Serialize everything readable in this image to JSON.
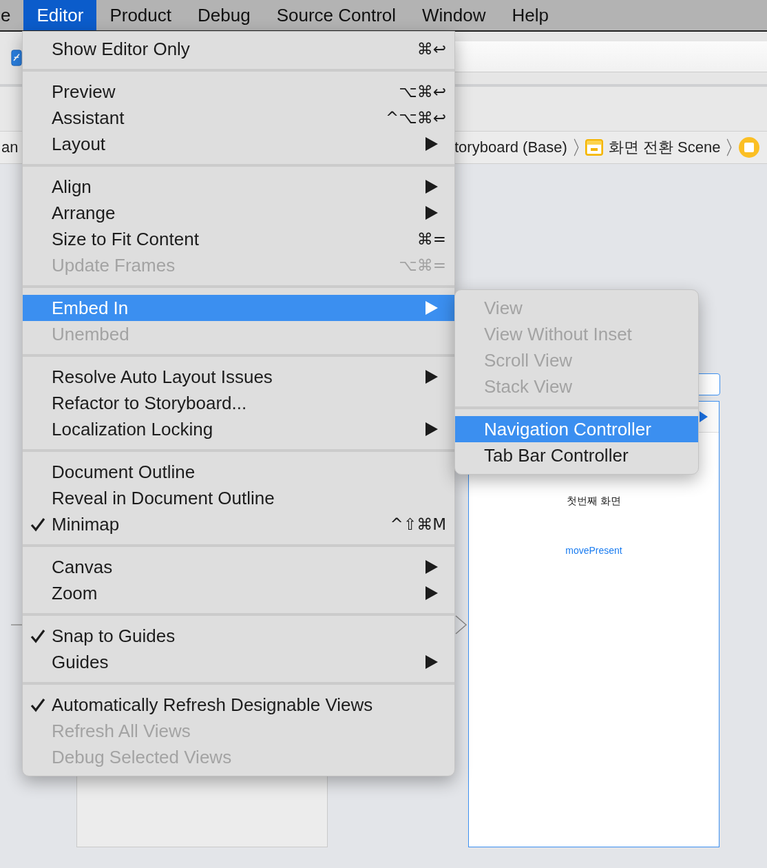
{
  "menubar": [
    {
      "label": "e",
      "selected": false
    },
    {
      "label": "Editor",
      "selected": true
    },
    {
      "label": "Product",
      "selected": false
    },
    {
      "label": "Debug",
      "selected": false
    },
    {
      "label": "Source Control",
      "selected": false
    },
    {
      "label": "Window",
      "selected": false
    },
    {
      "label": "Help",
      "selected": false
    }
  ],
  "breadcrumb": {
    "fragment": "an",
    "items": [
      {
        "label": "toryboard (Base)"
      },
      {
        "label": "화면 전환 Scene"
      }
    ]
  },
  "menu": {
    "groups": [
      [
        {
          "label": "Show Editor Only",
          "shortcut": "⌘↩",
          "kind": "command",
          "checked": false,
          "disabled": false,
          "selected": false
        }
      ],
      [
        {
          "label": "Preview",
          "shortcut": "⌥⌘↩",
          "kind": "command",
          "checked": false,
          "disabled": false,
          "selected": false
        },
        {
          "label": "Assistant",
          "shortcut": "^⌥⌘↩",
          "kind": "command",
          "checked": false,
          "disabled": false,
          "selected": false
        },
        {
          "label": "Layout",
          "kind": "submenu",
          "checked": false,
          "disabled": false,
          "selected": false
        }
      ],
      [
        {
          "label": "Align",
          "kind": "submenu",
          "checked": false,
          "disabled": false,
          "selected": false
        },
        {
          "label": "Arrange",
          "kind": "submenu",
          "checked": false,
          "disabled": false,
          "selected": false
        },
        {
          "label": "Size to Fit Content",
          "shortcut": "⌘=",
          "kind": "command",
          "checked": false,
          "disabled": false,
          "selected": false
        },
        {
          "label": "Update Frames",
          "shortcut": "⌥⌘=",
          "kind": "command",
          "checked": false,
          "disabled": true,
          "selected": false
        }
      ],
      [
        {
          "label": "Embed In",
          "kind": "submenu",
          "checked": false,
          "disabled": false,
          "selected": true
        },
        {
          "label": "Unembed",
          "kind": "command",
          "checked": false,
          "disabled": true,
          "selected": false
        }
      ],
      [
        {
          "label": "Resolve Auto Layout Issues",
          "kind": "submenu",
          "checked": false,
          "disabled": false,
          "selected": false
        },
        {
          "label": "Refactor to Storyboard...",
          "kind": "command",
          "checked": false,
          "disabled": false,
          "selected": false
        },
        {
          "label": "Localization Locking",
          "kind": "submenu",
          "checked": false,
          "disabled": false,
          "selected": false
        }
      ],
      [
        {
          "label": "Document Outline",
          "kind": "command",
          "checked": false,
          "disabled": false,
          "selected": false
        },
        {
          "label": "Reveal in Document Outline",
          "kind": "command",
          "checked": false,
          "disabled": false,
          "selected": false
        },
        {
          "label": "Minimap",
          "shortcut": "^⇧⌘M",
          "kind": "command",
          "checked": true,
          "disabled": false,
          "selected": false
        }
      ],
      [
        {
          "label": "Canvas",
          "kind": "submenu",
          "checked": false,
          "disabled": false,
          "selected": false
        },
        {
          "label": "Zoom",
          "kind": "submenu",
          "checked": false,
          "disabled": false,
          "selected": false
        }
      ],
      [
        {
          "label": "Snap to Guides",
          "kind": "command",
          "checked": true,
          "disabled": false,
          "selected": false
        },
        {
          "label": "Guides",
          "kind": "submenu",
          "checked": false,
          "disabled": false,
          "selected": false
        }
      ],
      [
        {
          "label": "Automatically Refresh Designable Views",
          "kind": "command",
          "checked": true,
          "disabled": false,
          "selected": false
        },
        {
          "label": "Refresh All Views",
          "kind": "command",
          "checked": false,
          "disabled": true,
          "selected": false
        },
        {
          "label": "Debug Selected Views",
          "kind": "command",
          "checked": false,
          "disabled": true,
          "selected": false
        }
      ]
    ]
  },
  "submenu": {
    "groups": [
      [
        {
          "label": "View",
          "disabled": true,
          "selected": false
        },
        {
          "label": "View Without Inset",
          "disabled": true,
          "selected": false
        },
        {
          "label": "Scroll View",
          "disabled": true,
          "selected": false
        },
        {
          "label": "Stack View",
          "disabled": true,
          "selected": false
        }
      ],
      [
        {
          "label": "Navigation Controller",
          "disabled": false,
          "selected": true
        },
        {
          "label": "Tab Bar Controller",
          "disabled": false,
          "selected": false
        }
      ]
    ]
  },
  "scene": {
    "label": "첫번째 화면",
    "button": "movePresent"
  }
}
